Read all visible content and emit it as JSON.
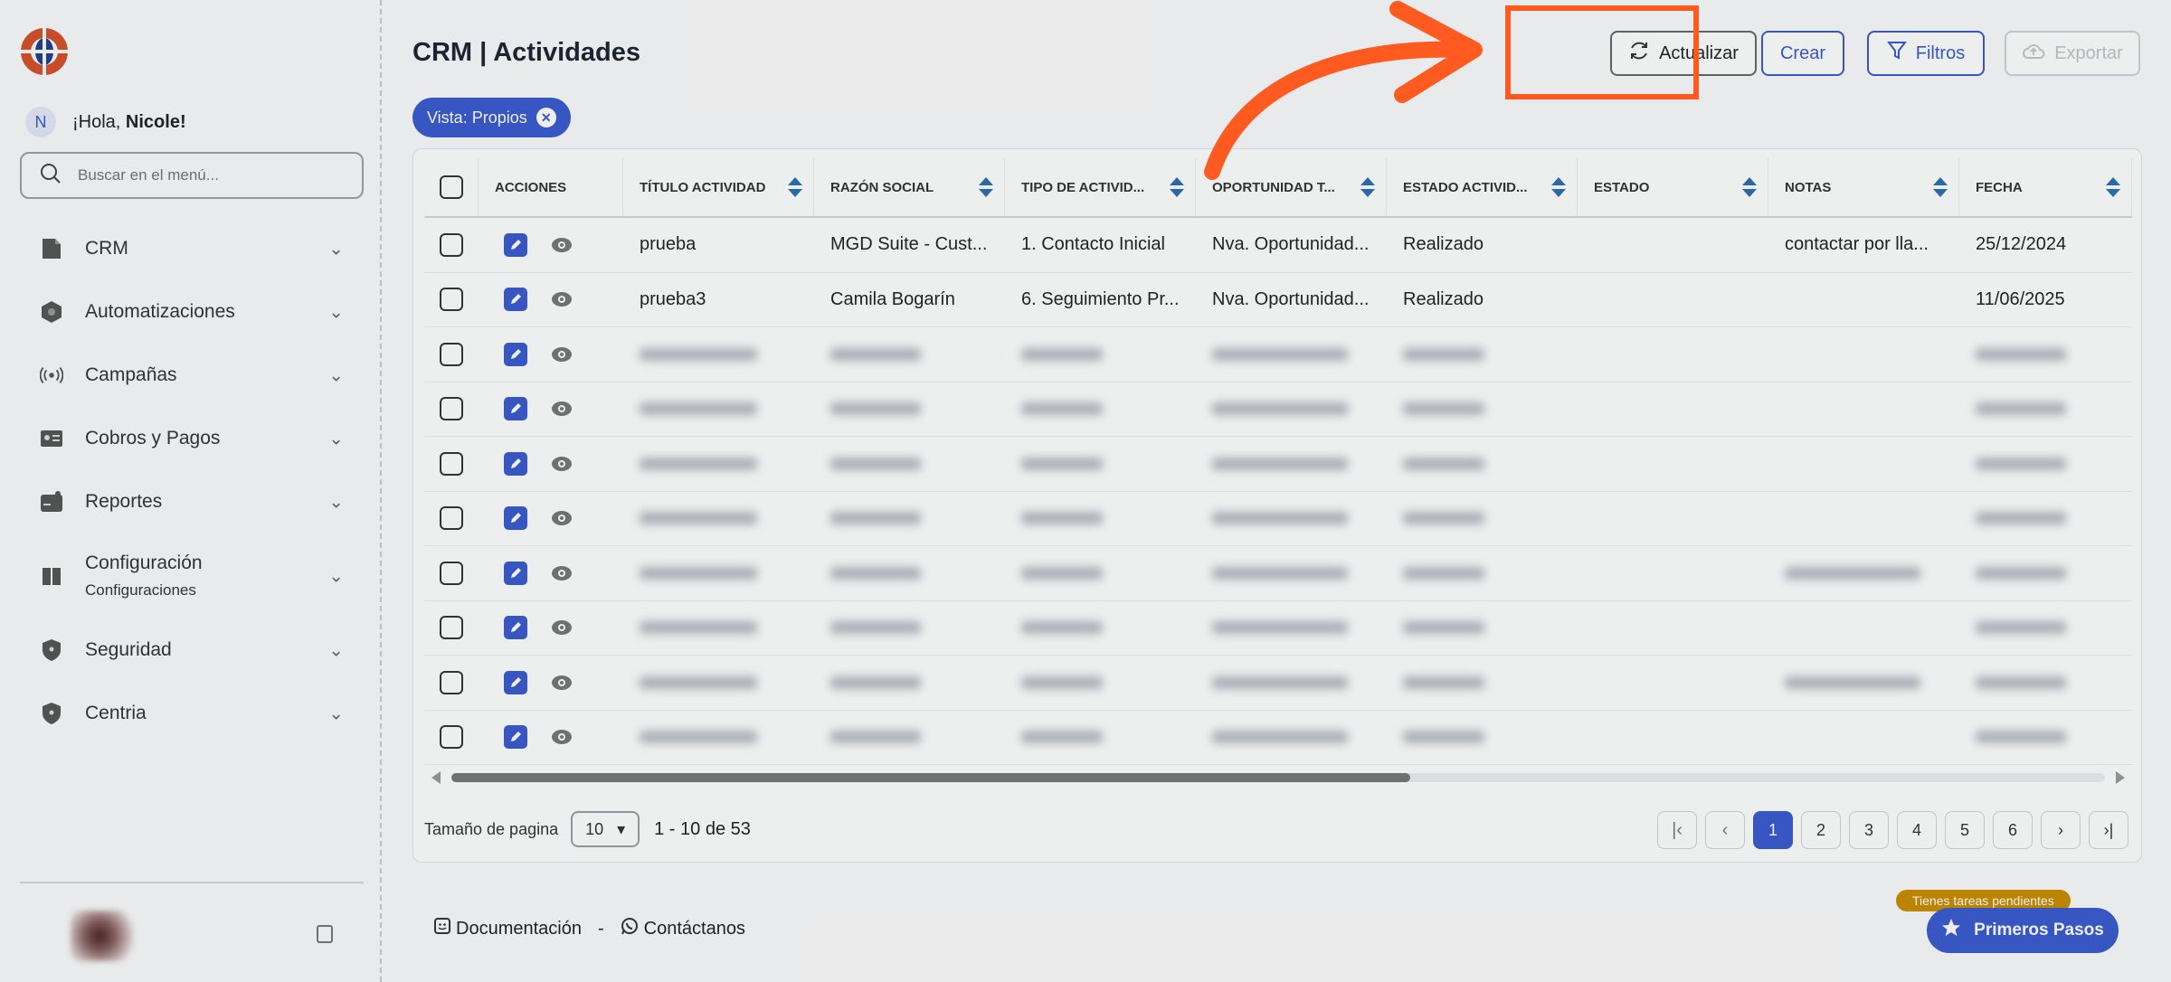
{
  "sidebar": {
    "greeting_prefix": "¡Hola,",
    "user_name": "Nicole!",
    "avatar_initial": "N",
    "search_placeholder": "Buscar en el menú...",
    "items": [
      {
        "label": "CRM",
        "icon": "document-icon"
      },
      {
        "label": "Automatizaciones",
        "icon": "hexagon-icon"
      },
      {
        "label": "Campañas",
        "icon": "broadcast-icon"
      },
      {
        "label": "Cobros y Pagos",
        "icon": "id-card-icon"
      },
      {
        "label": "Reportes",
        "icon": "wallet-icon"
      },
      {
        "label": "Configuración",
        "sub": "Configuraciones",
        "icon": "book-icon"
      },
      {
        "label": "Seguridad",
        "icon": "shield-icon"
      },
      {
        "label": "Centria",
        "icon": "shield-icon"
      }
    ]
  },
  "header": {
    "title": "CRM | Actividades",
    "refresh_label": "Actualizar",
    "create_label": "Crear",
    "filter_label": "Filtros",
    "export_label": "Exportar",
    "more_label": "···"
  },
  "chip": {
    "label": "Vista: Propios",
    "close": "✕"
  },
  "table": {
    "columns": [
      "Acciones",
      "Título Actividad",
      "Razón Social",
      "Tipo de Activid...",
      "Oportunidad T...",
      "Estado Activid...",
      "Estado",
      "Notas",
      "Fecha"
    ],
    "rows": [
      {
        "titulo": "prueba",
        "razon": "MGD Suite - Cust...",
        "tipo": "1. Contacto Inicial",
        "oportunidad": "Nva. Oportunidad...",
        "estado_act": "Realizado",
        "estado": "",
        "notas": "contactar por lla...",
        "fecha": "25/12/2024"
      },
      {
        "titulo": "prueba3",
        "razon": "Camila Bogarín",
        "tipo": "6. Seguimiento Pr...",
        "oportunidad": "Nva. Oportunidad...",
        "estado_act": "Realizado",
        "estado": "",
        "notas": "",
        "fecha": "11/06/2025"
      }
    ]
  },
  "pagination": {
    "page_size_label": "Tamaño de pagina",
    "page_size": "10",
    "range": "1 - 10 de 53",
    "pages": [
      "1",
      "2",
      "3",
      "4",
      "5",
      "6"
    ],
    "first": "|‹",
    "prev": "‹",
    "next": "›",
    "last": "›|"
  },
  "footer": {
    "docs_label": "Documentación",
    "separator": "-",
    "contact_label": "Contáctanos"
  },
  "tasks_badge": "Tienes tareas pendientes",
  "steps_button": "Primeros Pasos",
  "colors": {
    "accent": "#3a5bd0",
    "highlight": "#ff5a1f",
    "badge": "#c98e00"
  }
}
